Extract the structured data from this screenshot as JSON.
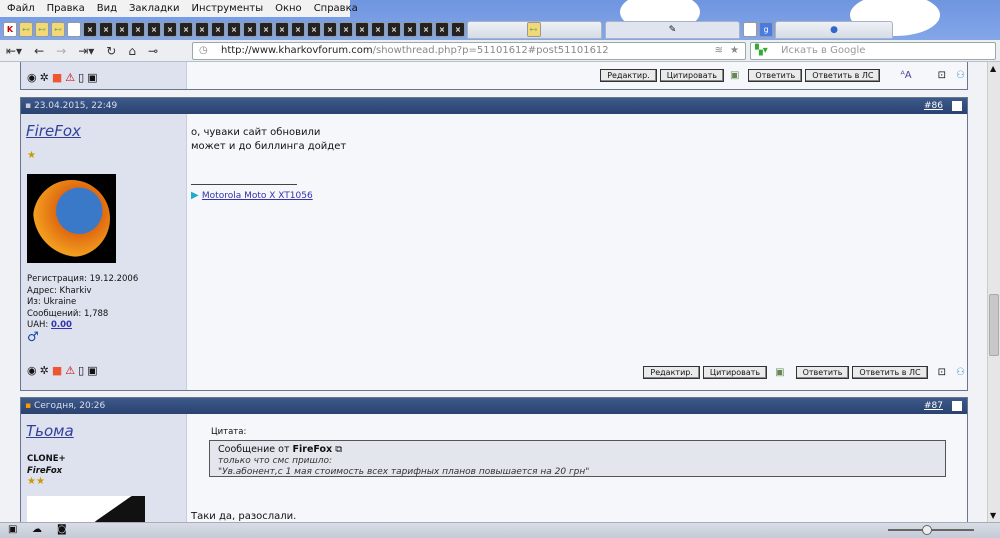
{
  "menu": [
    "Файл",
    "Правка",
    "Вид",
    "Закладки",
    "Инструменты",
    "Окно",
    "Справка"
  ],
  "nav": {
    "url_host": "http://www.kharkovforum.com",
    "url_path": "/showthread.php?p=51101612#post51101612",
    "search_placeholder": "Искать в Google"
  },
  "buttons": {
    "edit": "Редактир.",
    "quote": "Цитировать",
    "reply": "Ответить",
    "reply_pm": "Ответить в ЛС"
  },
  "post86": {
    "date": "23.04.2015, 22:49",
    "number": "#86",
    "author": "FireFox",
    "lines": [
      "о, чуваки сайт обновили",
      "может и до биллинга дойдет"
    ],
    "signature_link": "Motorola Moto X XT1056",
    "info": {
      "reg": "Регистрация: 19.12.2006",
      "addr": "Адрес: Kharkiv",
      "from": "Из: Ukraine",
      "posts": "Сообщений: 1,788",
      "uah_label": "UAH: ",
      "uah": "0.00"
    }
  },
  "post87": {
    "date": "Сегодня, 20:26",
    "number": "#87",
    "author": "Тьома",
    "title": "CLONE+",
    "subtitle": "FireFox",
    "quote_label": "Цитата:",
    "quote_from": "Сообщение от ",
    "quote_author": "FireFox",
    "quote_lines": [
      "только что смс пришло:",
      "\"Ув.абонент,с 1 мая стоимость всех тарифных планов повышается на 20 грн\""
    ],
    "text": "Таки да, разослали."
  }
}
